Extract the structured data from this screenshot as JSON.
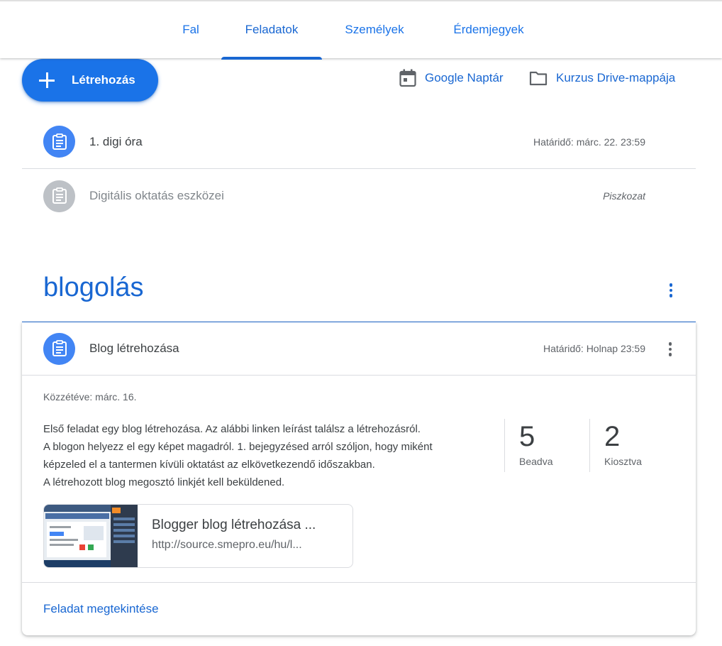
{
  "tabs": [
    {
      "label": "Fal",
      "active": false
    },
    {
      "label": "Feladatok",
      "active": true
    },
    {
      "label": "Személyek",
      "active": false
    },
    {
      "label": "Érdemjegyek",
      "active": false
    }
  ],
  "toolbar": {
    "create_label": "Létrehozás",
    "calendar_label": "Google Naptár",
    "drive_label": "Kurzus Drive-mappája"
  },
  "assignments": [
    {
      "title": "1. digi óra",
      "due": "Határidő: márc. 22. 23:59",
      "icon": "assignment-icon",
      "state": "published"
    },
    {
      "title": "Digitális oktatás eszközei",
      "due": "Piszkozat",
      "icon": "assignment-icon",
      "state": "draft"
    }
  ],
  "topic": {
    "title": "blogolás",
    "card": {
      "title": "Blog létrehozása",
      "due": "Határidő: Holnap 23:59",
      "posted": "Közzétéve: márc. 16.",
      "description": [
        "Első feladat egy blog létrehozása. Az alábbi linken leírást találsz a létrehozásról.",
        "A blogon helyezz el egy képet magadról. 1. bejegyzésed arról szóljon, hogy miként",
        "képzeled el a tantermen kívüli oktatást az elkövetkezendő időszakban.",
        "A létrehozott blog megosztó linkjét kell beküldened."
      ],
      "stats": [
        {
          "value": "5",
          "label": "Beadva"
        },
        {
          "value": "2",
          "label": "Kiosztva"
        }
      ],
      "attachment": {
        "title": "Blogger blog létrehozása ...",
        "url": "http://source.smepro.eu/hu/l..."
      },
      "view_label": "Feladat megtekintése"
    }
  },
  "colors": {
    "primary": "#1a73e8",
    "link": "#1967d2",
    "assignment_icon_bg": "#4285f4",
    "draft_icon_bg": "#bdc1c6"
  }
}
